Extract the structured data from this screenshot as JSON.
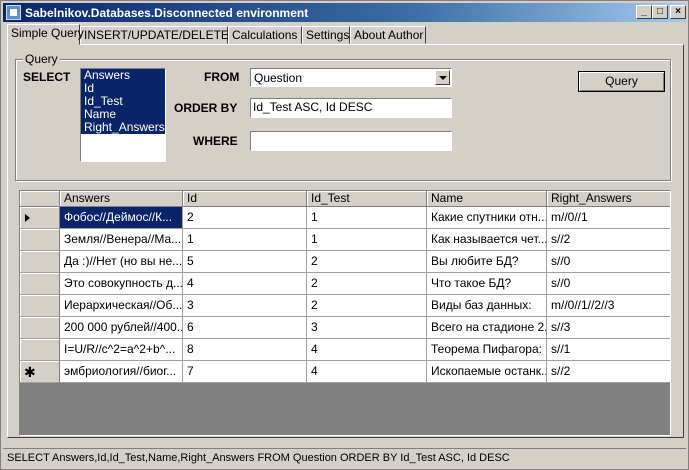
{
  "window": {
    "title": "Sabelnikov.Databases.Disconnected environment",
    "minimize_glyph": "_",
    "maximize_glyph": "□",
    "close_glyph": "×"
  },
  "tabs": [
    {
      "label": "Simple Query",
      "active": true
    },
    {
      "label": "INSERT/UPDATE/DELETE"
    },
    {
      "label": "Calculations"
    },
    {
      "label": "Settings"
    },
    {
      "label": "About Author"
    }
  ],
  "query": {
    "group_label": "Query",
    "select_label": "SELECT",
    "select_items": [
      "Answers",
      "Id",
      "Id_Test",
      "Name",
      "Right_Answers"
    ],
    "from_label": "FROM",
    "from_value": "Question",
    "orderby_label": "ORDER BY",
    "orderby_value": "Id_Test ASC, Id DESC",
    "where_label": "WHERE",
    "where_value": "",
    "query_button": "Query"
  },
  "grid": {
    "columns": [
      "Answers",
      "Id",
      "Id_Test",
      "Name",
      "Right_Answers"
    ],
    "rows": [
      {
        "marker": "current",
        "cells": [
          "Фобос//Деймос//К...",
          "2",
          "1",
          "Какие спутники отн...",
          "m//0//1"
        ]
      },
      {
        "cells": [
          "Земля//Венера//Ма...",
          "1",
          "1",
          "Как называется чет...",
          "s//2"
        ]
      },
      {
        "cells": [
          "Да :)//Нет (но вы не...",
          "5",
          "2",
          "Вы любите БД?",
          "s//0"
        ]
      },
      {
        "cells": [
          "Это совокупность д...",
          "4",
          "2",
          "Что такое БД?",
          "s//0"
        ]
      },
      {
        "cells": [
          "Иерархическая//Об...",
          "3",
          "2",
          "Виды баз данных:",
          "m//0//1//2//3"
        ]
      },
      {
        "cells": [
          "200 000 рублей//400...",
          "6",
          "3",
          "Всего на стадионе 2...",
          "s//3"
        ]
      },
      {
        "cells": [
          "I=U/R//c^2=a^2+b^...",
          "8",
          "4",
          "Теорема Пифагора:",
          "s//1"
        ]
      },
      {
        "marker": "new",
        "cells": [
          "эмбриология//биог...",
          "7",
          "4",
          "Ископаемые останк...",
          "s//2"
        ]
      }
    ]
  },
  "status": {
    "text": "SELECT Answers,Id,Id_Test,Name,Right_Answers FROM Question ORDER BY Id_Test ASC, Id DESC"
  }
}
